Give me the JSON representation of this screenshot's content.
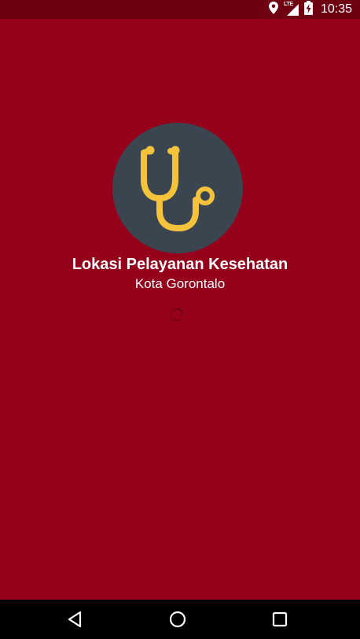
{
  "status_bar": {
    "time": "10:35",
    "network_label": "LTE",
    "icons": [
      "location-icon",
      "signal-icon",
      "battery-icon"
    ]
  },
  "splash": {
    "title": "Lokasi Pelayanan Kesehatan",
    "subtitle": "Kota Gorontalo",
    "logo_icon": "stethoscope-icon",
    "loading_indicator": "progress-spinner"
  },
  "navigation": {
    "buttons": [
      "back-button",
      "home-button",
      "recents-button"
    ]
  },
  "colors": {
    "background": "#95001a",
    "status_bar": "#6e0012",
    "logo_circle": "#3a4550",
    "logo_accent": "#f5c33b",
    "nav_bar": "#000000"
  }
}
